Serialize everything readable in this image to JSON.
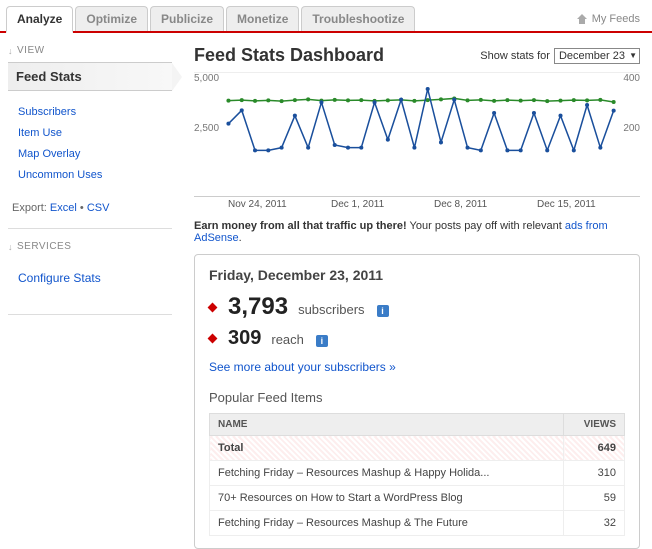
{
  "tabs": [
    "Analyze",
    "Optimize",
    "Publicize",
    "Monetize",
    "Troubleshootize"
  ],
  "activeTab": "Analyze",
  "myFeeds": "My Feeds",
  "sidebar": {
    "viewHead": "VIEW",
    "feedStats": "Feed Stats",
    "links": [
      "Subscribers",
      "Item Use",
      "Map Overlay",
      "Uncommon Uses"
    ],
    "exportLabel": "Export:",
    "exportExcel": "Excel",
    "exportCsv": "CSV",
    "servicesHead": "SERVICES",
    "configure": "Configure Stats"
  },
  "main": {
    "title": "Feed Stats Dashboard",
    "showStatsLabel": "Show stats for",
    "dateSelected": "December 23",
    "earnBold": "Earn money from all that traffic up there!",
    "earnText": " Your posts pay off with relevant ",
    "earnLink": "ads from AdSense",
    "dateHeading": "Friday, December 23, 2011",
    "subscribersNum": "3,793",
    "subscribersLabel": "subscribers",
    "reachNum": "309",
    "reachLabel": "reach",
    "seeMore": "See more about your subscribers »",
    "popularHead": "Popular Feed Items",
    "colName": "NAME",
    "colViews": "VIEWS",
    "rows": [
      {
        "name": "Total",
        "views": "649",
        "total": true
      },
      {
        "name": "Fetching Friday – Resources Mashup & Happy Holida...",
        "views": "310"
      },
      {
        "name": "70+ Resources on How to Start a WordPress Blog",
        "views": "59"
      },
      {
        "name": "Fetching Friday – Resources Mashup & The Future",
        "views": "32"
      }
    ]
  },
  "chart_data": {
    "type": "line",
    "x_ticks": [
      "Nov 24, 2011",
      "Dec 1, 2011",
      "Dec 8, 2011",
      "Dec 15, 2011"
    ],
    "series": [
      {
        "name": "subscribers",
        "color": "#2a8a2a",
        "yaxis": "left",
        "values": [
          3850,
          3870,
          3840,
          3860,
          3830,
          3870,
          3900,
          3850,
          3880,
          3860,
          3870,
          3840,
          3860,
          3880,
          3840,
          3870,
          3900,
          3940,
          3860,
          3880,
          3840,
          3870,
          3850,
          3870,
          3830,
          3850,
          3870,
          3860,
          3880,
          3793
        ]
      },
      {
        "name": "reach",
        "color": "#1a4f9c",
        "yaxis": "right",
        "values": [
          260,
          310,
          160,
          160,
          170,
          290,
          170,
          340,
          180,
          170,
          170,
          340,
          200,
          350,
          170,
          390,
          190,
          350,
          170,
          160,
          300,
          160,
          160,
          300,
          160,
          290,
          160,
          330,
          170,
          309
        ]
      }
    ],
    "yleft": {
      "ticks": [
        2500,
        5000
      ],
      "range": [
        0,
        5000
      ]
    },
    "yright": {
      "ticks": [
        200,
        400
      ],
      "range": [
        0,
        450
      ]
    }
  }
}
